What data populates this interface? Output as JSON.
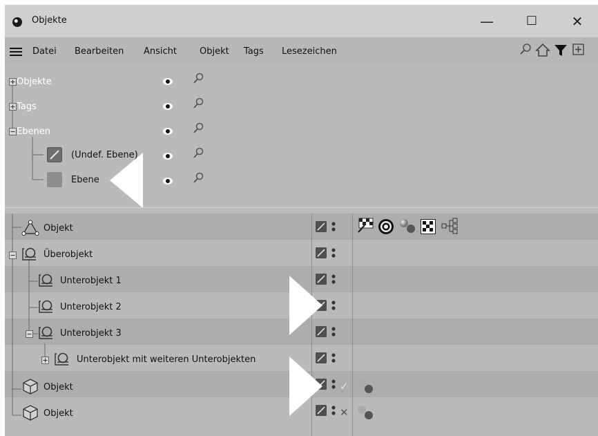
{
  "window": {
    "title": "Objekte",
    "minimize": "—",
    "maximize": "☐",
    "close": "✕"
  },
  "menu": {
    "items": [
      "Datei",
      "Bearbeiten",
      "Ansicht",
      "Objekt",
      "Tags",
      "Lesezeichen"
    ]
  },
  "layers": {
    "items": [
      {
        "label": "Objekte",
        "expander": "plus"
      },
      {
        "label": "Tags",
        "expander": "plus"
      },
      {
        "label": "Ebenen",
        "expander": "minus"
      },
      {
        "label": "(Undef. Ebene)",
        "icon": "undefined-layer-icon"
      },
      {
        "label": "Ebene",
        "icon": "layer-color-swatch"
      }
    ]
  },
  "objects": {
    "rows": [
      {
        "label": "Objekt",
        "icon": "polygon-object-icon",
        "status": "",
        "tags": [
          "pin-tag-icon",
          "target-tag-icon",
          "material-spheres-icon",
          "checker-texture-icon",
          "node-tree-icon"
        ]
      },
      {
        "label": "Überobjekt",
        "icon": "null-object-icon",
        "status": "",
        "tags": []
      },
      {
        "label": "Unterobjekt 1",
        "icon": "null-object-icon",
        "status": "",
        "tags": []
      },
      {
        "label": "Unterobjekt 2",
        "icon": "null-object-icon",
        "status": "",
        "tags": []
      },
      {
        "label": "Unterobjekt 3",
        "icon": "null-object-icon",
        "status": "",
        "tags": []
      },
      {
        "label": "Unterobjekt mit weiteren Unterobjekten",
        "icon": "null-object-icon",
        "status": "",
        "tags": []
      },
      {
        "label": "Objekt",
        "icon": "cube-object-icon",
        "status": "✓",
        "tags": [
          "material-spheres-icon"
        ]
      },
      {
        "label": "Objekt",
        "icon": "cube-object-icon",
        "status": "✕",
        "tags": [
          "material-spheres-icon"
        ]
      }
    ]
  },
  "colors": {
    "title_bg": "#cfcfcf",
    "panel_bg": "#b9b9b9",
    "row_dark": "#adadad",
    "row_light": "#bababa",
    "layer_text": "#ffffff",
    "layer_swatch": "#8e8e8e"
  }
}
